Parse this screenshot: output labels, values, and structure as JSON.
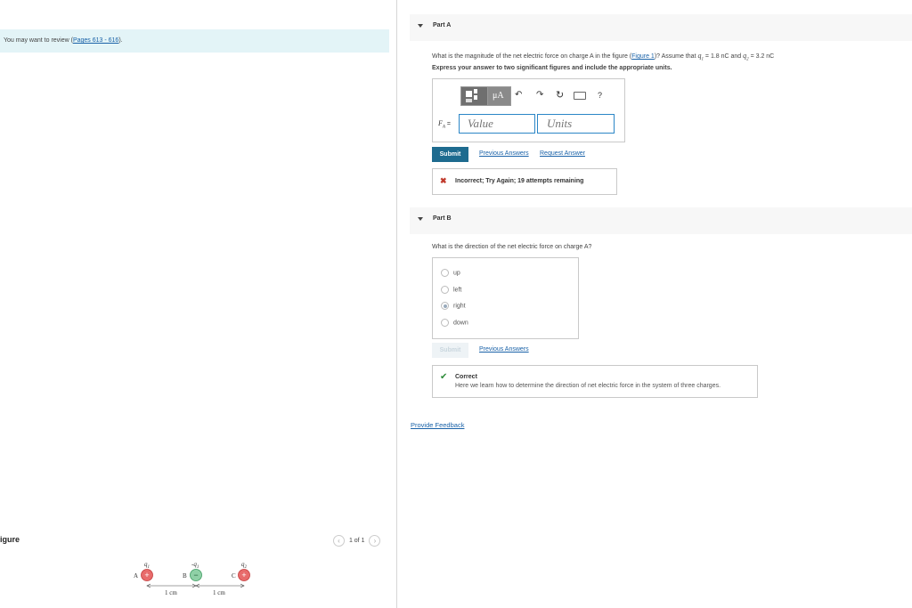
{
  "left": {
    "review_prefix": "You may want to review (",
    "review_link": "Pages 613 - 616",
    "review_suffix": ").",
    "figure_title": "igure",
    "pager": "1 of 1",
    "pager_prev_icon": "chevron-left-icon",
    "pager_next_icon": "chevron-right-icon"
  },
  "figure": {
    "charges": [
      {
        "point": "A",
        "symbol": "q",
        "sub": "1",
        "sign": "+",
        "color": "#e24a4a"
      },
      {
        "point": "B",
        "symbol": "-q",
        "sub": "1",
        "sign": "−",
        "color": "#3fa66a"
      },
      {
        "point": "C",
        "symbol": "q",
        "sub": "2",
        "sign": "+",
        "color": "#e24a4a"
      }
    ],
    "spacing_labels": [
      "1 cm",
      "1 cm"
    ]
  },
  "partA": {
    "title": "Part A",
    "question_prefix": "What is the magnitude of the net electric force on charge A in the figure (",
    "figure_link": "Figure 1",
    "question_mid": ")? Assume that ",
    "q1": "q",
    "q1_sub": "1",
    "q1_val": " = 1.8 nC and ",
    "q2": "q",
    "q2_sub": "2",
    "q2_val": " = 3.2 nC",
    "instruction": "Express your answer to two significant figures and include the appropriate units.",
    "toolbar": {
      "units_label": "μA",
      "help_label": "?",
      "icons": [
        "templates-icon",
        "units-icon",
        "undo-icon",
        "redo-icon",
        "reset-icon",
        "keyboard-icon",
        "help-icon"
      ]
    },
    "answer_label": "F",
    "answer_sub": "A",
    "answer_eq": " =",
    "value_placeholder": "Value",
    "units_placeholder": "Units",
    "submit_label": "Submit",
    "previous_answers": "Previous Answers",
    "request_answer": "Request Answer",
    "feedback": "Incorrect; Try Again; 19 attempts remaining",
    "feedback_color": "#c0392b"
  },
  "partB": {
    "title": "Part B",
    "question": "What is the direction of the net electric force on charge A?",
    "options": [
      "up",
      "left",
      "right",
      "down"
    ],
    "selected": "right",
    "submit_label": "Submit",
    "previous_answers": "Previous Answers",
    "feedback_title": "Correct",
    "feedback_text": "Here we learn how to determine the direction of net electric force in the system of three charges.",
    "correct_color": "#2e8b3a"
  },
  "provide_feedback": "Provide Feedback"
}
